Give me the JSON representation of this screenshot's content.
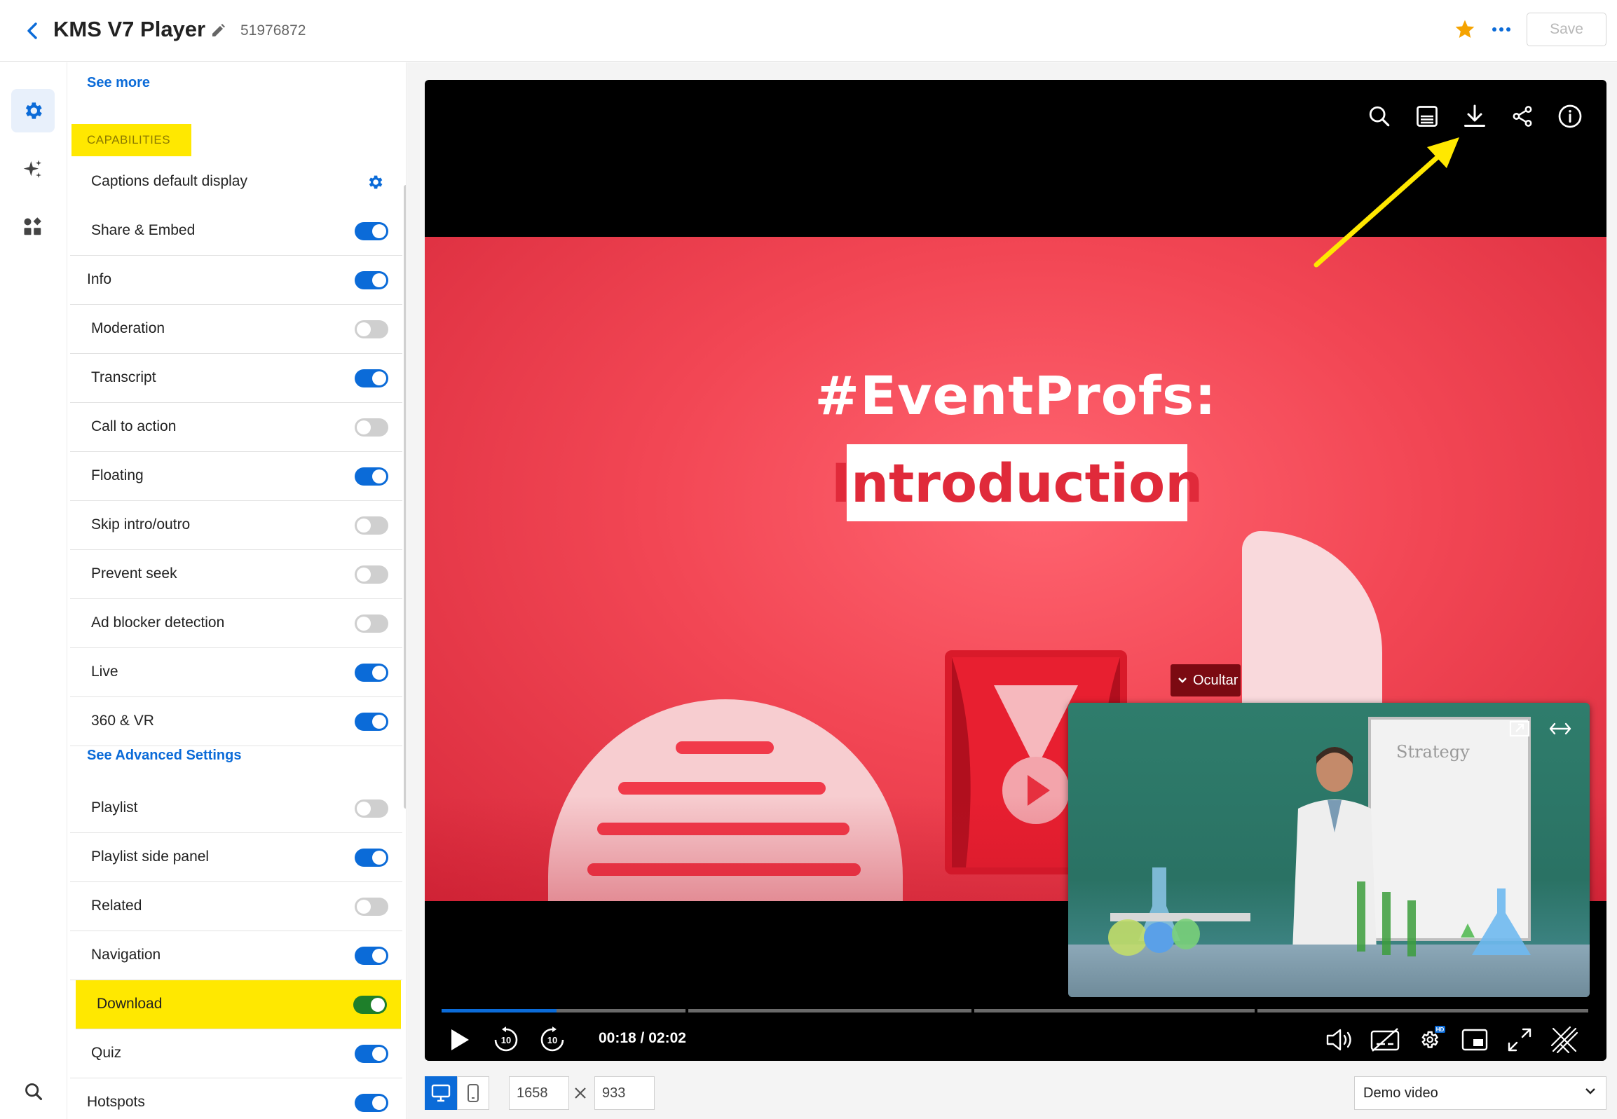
{
  "header": {
    "title": "KMS V7 Player",
    "player_id": "51976872",
    "save_label": "Save",
    "back_icon": "chevron-left-icon",
    "edit_icon": "pencil-icon",
    "star_icon": "star-icon",
    "more_icon": "more-dots-icon",
    "star_color": "#f5a300",
    "accent_color": "#0b6bd8"
  },
  "rail": {
    "items": [
      {
        "icon": "gear-icon",
        "active": true
      },
      {
        "icon": "sparkles-icon",
        "active": false
      },
      {
        "icon": "plugins-icon",
        "active": false
      }
    ],
    "search_icon": "search-icon"
  },
  "panel": {
    "see_more": "See more",
    "section_label": "CAPABILITIES",
    "captions": {
      "label": "Captions default display",
      "icon": "gear-icon"
    },
    "items_a": [
      {
        "label": "Share & Embed",
        "on": true
      },
      {
        "label": "Info",
        "on": true
      },
      {
        "label": "Moderation",
        "on": false
      },
      {
        "label": "Transcript",
        "on": true
      },
      {
        "label": "Call to action",
        "on": false
      },
      {
        "label": "Floating",
        "on": true
      },
      {
        "label": "Skip intro/outro",
        "on": false
      },
      {
        "label": "Prevent seek",
        "on": false
      },
      {
        "label": "Ad blocker detection",
        "on": false
      },
      {
        "label": "Live",
        "on": true
      },
      {
        "label": "360 & VR",
        "on": true
      }
    ],
    "advanced_link": "See Advanced Settings",
    "items_b": [
      {
        "label": "Playlist",
        "on": false
      },
      {
        "label": "Playlist side panel",
        "on": true
      },
      {
        "label": "Related",
        "on": false
      },
      {
        "label": "Navigation",
        "on": true
      },
      {
        "label": "Download",
        "on": true,
        "highlight": true
      },
      {
        "label": "Quiz",
        "on": true
      },
      {
        "label": "Hotspots",
        "on": true
      }
    ],
    "highlight_color": "#ffe800"
  },
  "player": {
    "top_icons": [
      "search-icon",
      "captions-icon",
      "download-icon",
      "share-icon",
      "info-icon"
    ],
    "slide": {
      "headline": "#EventProfs:",
      "subtitle": "Introduction"
    },
    "hide_label": "Ocultar",
    "pip": {
      "board_text": "Strategy",
      "icons": [
        "expand-icon",
        "swap-icon"
      ]
    },
    "progress": 0.1,
    "time": "00:18 / 02:02",
    "controls_left": [
      "play-icon",
      "rewind-10-icon",
      "forward-10-icon"
    ],
    "controls_right": [
      "volume-icon",
      "captions-off-icon",
      "settings-hd-icon",
      "pip-icon",
      "fullscreen-icon",
      "logo-icon"
    ]
  },
  "bottom": {
    "device_icons": [
      "desktop-icon",
      "mobile-icon"
    ],
    "width": "1658",
    "height": "933",
    "times_icon": "times-icon",
    "select_value": "Demo video",
    "caret_icon": "chevron-down-icon"
  },
  "annotation": {
    "arrow_color": "#ffe800"
  }
}
